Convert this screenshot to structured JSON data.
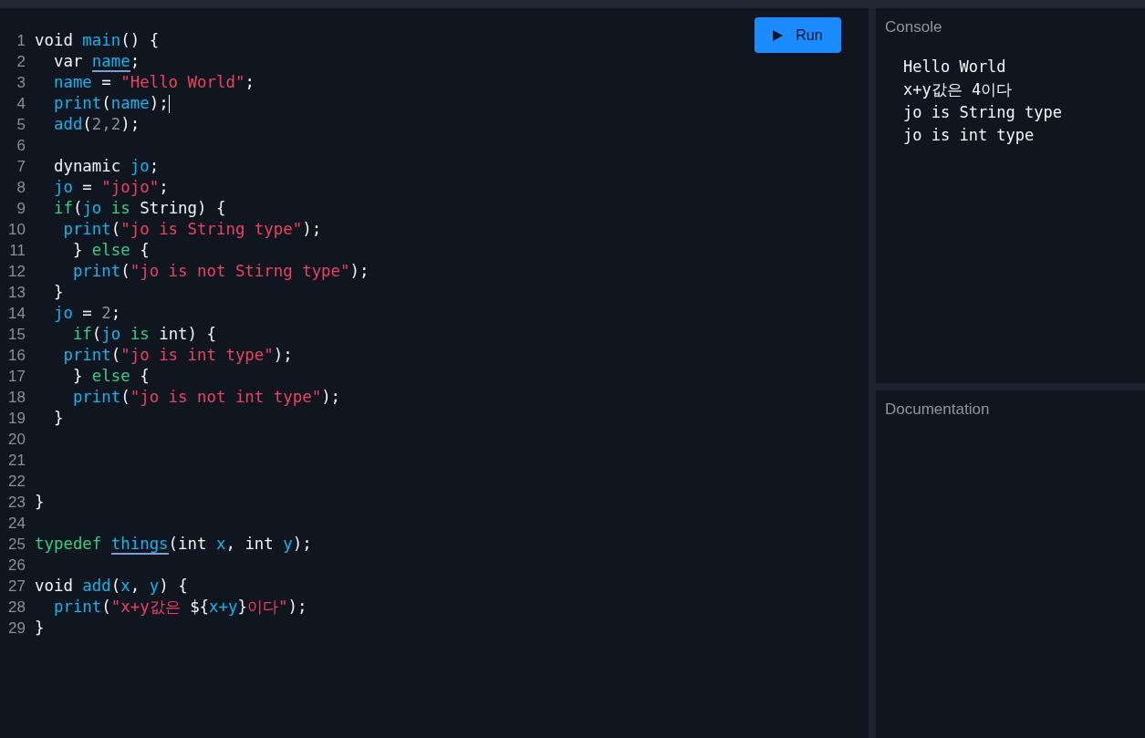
{
  "editor": {
    "run_button": {
      "label": "Run"
    },
    "lines": [
      {
        "number": "1",
        "cursor": false,
        "tokens": [
          {
            "kind": "plain",
            "text": "void "
          },
          {
            "kind": "name",
            "text": "main"
          },
          {
            "kind": "plain",
            "text": "() {"
          }
        ]
      },
      {
        "number": "2",
        "cursor": false,
        "tokens": [
          {
            "kind": "plain",
            "text": "  var "
          },
          {
            "kind": "marked",
            "text": "name"
          },
          {
            "kind": "plain",
            "text": ";"
          }
        ]
      },
      {
        "number": "3",
        "cursor": false,
        "tokens": [
          {
            "kind": "name",
            "text": "  name"
          },
          {
            "kind": "plain",
            "text": " = "
          },
          {
            "kind": "string",
            "text": "\"Hello World\""
          },
          {
            "kind": "plain",
            "text": ";"
          }
        ]
      },
      {
        "number": "4",
        "cursor": true,
        "tokens": [
          {
            "kind": "name",
            "text": "  print"
          },
          {
            "kind": "plain",
            "text": "("
          },
          {
            "kind": "name",
            "text": "name"
          },
          {
            "kind": "plain",
            "text": ");"
          }
        ]
      },
      {
        "number": "5",
        "cursor": false,
        "tokens": [
          {
            "kind": "name",
            "text": "  add"
          },
          {
            "kind": "plain",
            "text": "("
          },
          {
            "kind": "number",
            "text": "2,2"
          },
          {
            "kind": "plain",
            "text": ");"
          }
        ]
      },
      {
        "number": "6",
        "cursor": false
      },
      {
        "number": "7",
        "cursor": false,
        "tokens": [
          {
            "kind": "plain",
            "text": "  dynamic "
          },
          {
            "kind": "name",
            "text": "jo"
          },
          {
            "kind": "plain",
            "text": ";"
          }
        ]
      },
      {
        "number": "8",
        "cursor": false,
        "tokens": [
          {
            "kind": "name",
            "text": "  jo"
          },
          {
            "kind": "plain",
            "text": " = "
          },
          {
            "kind": "string",
            "text": "\"jojo\""
          },
          {
            "kind": "plain",
            "text": ";"
          }
        ]
      },
      {
        "number": "9",
        "cursor": false,
        "tokens": [
          {
            "kind": "keyword",
            "text": "  if"
          },
          {
            "kind": "plain",
            "text": "("
          },
          {
            "kind": "name",
            "text": "jo"
          },
          {
            "kind": "keyword",
            "text": " is "
          },
          {
            "kind": "plain",
            "text": "String) {"
          }
        ]
      },
      {
        "number": "10",
        "cursor": false,
        "tokens": [
          {
            "kind": "name",
            "text": "   print"
          },
          {
            "kind": "plain",
            "text": "("
          },
          {
            "kind": "string",
            "text": "\"jo is String type\""
          },
          {
            "kind": "plain",
            "text": ");"
          }
        ]
      },
      {
        "number": "11",
        "cursor": false,
        "tokens": [
          {
            "kind": "plain",
            "text": "    } "
          },
          {
            "kind": "keyword",
            "text": "else"
          },
          {
            "kind": "plain",
            "text": " {"
          }
        ]
      },
      {
        "number": "12",
        "cursor": false,
        "tokens": [
          {
            "kind": "name",
            "text": "    print"
          },
          {
            "kind": "plain",
            "text": "("
          },
          {
            "kind": "string",
            "text": "\"jo is not Stirng type\""
          },
          {
            "kind": "plain",
            "text": ");"
          }
        ]
      },
      {
        "number": "13",
        "cursor": false,
        "tokens": [
          {
            "kind": "plain",
            "text": "  }"
          }
        ]
      },
      {
        "number": "14",
        "cursor": false,
        "tokens": [
          {
            "kind": "name",
            "text": "  jo"
          },
          {
            "kind": "plain",
            "text": " = "
          },
          {
            "kind": "number",
            "text": "2"
          },
          {
            "kind": "plain",
            "text": ";"
          }
        ]
      },
      {
        "number": "15",
        "cursor": false,
        "tokens": [
          {
            "kind": "keyword",
            "text": "    if"
          },
          {
            "kind": "plain",
            "text": "("
          },
          {
            "kind": "name",
            "text": "jo"
          },
          {
            "kind": "keyword",
            "text": " is "
          },
          {
            "kind": "plain",
            "text": "int) {"
          }
        ]
      },
      {
        "number": "16",
        "cursor": false,
        "tokens": [
          {
            "kind": "name",
            "text": "   print"
          },
          {
            "kind": "plain",
            "text": "("
          },
          {
            "kind": "string",
            "text": "\"jo is int type\""
          },
          {
            "kind": "plain",
            "text": ");"
          }
        ]
      },
      {
        "number": "17",
        "cursor": false,
        "tokens": [
          {
            "kind": "plain",
            "text": "    } "
          },
          {
            "kind": "keyword",
            "text": "else"
          },
          {
            "kind": "plain",
            "text": " {"
          }
        ]
      },
      {
        "number": "18",
        "cursor": false,
        "tokens": [
          {
            "kind": "name",
            "text": "    print"
          },
          {
            "kind": "plain",
            "text": "("
          },
          {
            "kind": "string",
            "text": "\"jo is not int type\""
          },
          {
            "kind": "plain",
            "text": ");"
          }
        ]
      },
      {
        "number": "19",
        "cursor": false,
        "tokens": [
          {
            "kind": "plain",
            "text": "  }"
          }
        ]
      },
      {
        "number": "20",
        "cursor": false
      },
      {
        "number": "21",
        "cursor": false
      },
      {
        "number": "22",
        "cursor": false
      },
      {
        "number": "23",
        "cursor": false,
        "tokens": [
          {
            "kind": "plain",
            "text": "}"
          }
        ]
      },
      {
        "number": "24",
        "cursor": false
      },
      {
        "number": "25",
        "cursor": false,
        "tokens": [
          {
            "kind": "keyword",
            "text": "typedef "
          },
          {
            "kind": "marked",
            "text": "things"
          },
          {
            "kind": "plain",
            "text": "(int "
          },
          {
            "kind": "name",
            "text": "x"
          },
          {
            "kind": "plain",
            "text": ", int "
          },
          {
            "kind": "name",
            "text": "y"
          },
          {
            "kind": "plain",
            "text": ");"
          }
        ]
      },
      {
        "number": "26",
        "cursor": false
      },
      {
        "number": "27",
        "cursor": false,
        "tokens": [
          {
            "kind": "plain",
            "text": "void "
          },
          {
            "kind": "name",
            "text": "add"
          },
          {
            "kind": "plain",
            "text": "("
          },
          {
            "kind": "name",
            "text": "x"
          },
          {
            "kind": "plain",
            "text": ", "
          },
          {
            "kind": "name",
            "text": "y"
          },
          {
            "kind": "plain",
            "text": ") {"
          }
        ]
      },
      {
        "number": "28",
        "cursor": false,
        "tokens": [
          {
            "kind": "name",
            "text": "  print"
          },
          {
            "kind": "plain",
            "text": "("
          },
          {
            "kind": "string",
            "text": "\"x+y값은 "
          },
          {
            "kind": "plain",
            "text": "${"
          },
          {
            "kind": "name",
            "text": "x+y"
          },
          {
            "kind": "plain",
            "text": "}"
          },
          {
            "kind": "string",
            "text": "이다\""
          },
          {
            "kind": "plain",
            "text": ");"
          }
        ]
      },
      {
        "number": "29",
        "cursor": false,
        "tokens": [
          {
            "kind": "plain",
            "text": "}"
          }
        ]
      }
    ]
  },
  "console": {
    "title": "Console",
    "output": [
      "Hello World",
      "x+y값은 4이다",
      "jo is String type",
      "jo is int type"
    ]
  },
  "documentation": {
    "title": "Documentation"
  }
}
